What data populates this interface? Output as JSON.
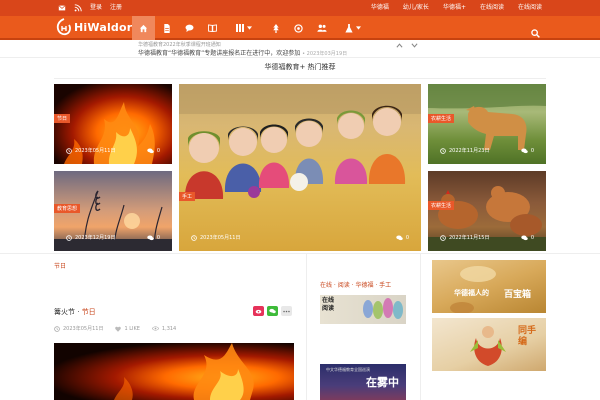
{
  "topbar": {
    "left_items": [
      "✉",
      "⤢",
      "登录",
      "注册"
    ],
    "right_items": [
      "华德福",
      "幼儿/家长",
      "华德福+",
      "在线阅读",
      "关于我们"
    ]
  },
  "nav": {
    "logo_text": "HiWaldorf",
    "items": [
      "home-icon",
      "file-icon",
      "comment-icon",
      "book-icon",
      "grid-icon",
      "tree-icon",
      "circle-icon",
      "users-icon",
      "flask-icon"
    ]
  },
  "ticker": {
    "line1": "华德福教育2022年秋季课程开班通知",
    "line2": "华德福教育“华德福教育”专题讲座报名正在进行中，欢迎参加",
    "date": "• 2023年03月19日"
  },
  "subtitle": "华德福教育+ 热门推荐",
  "tiles": [
    {
      "id": "fire",
      "cat": "节日",
      "date": "2023年05月11日",
      "comments": "0"
    },
    {
      "id": "felt",
      "cat": "手工",
      "date": "2023年05月11日",
      "comments": "0"
    },
    {
      "id": "cow",
      "cat": "农耕生活",
      "date": "2022年11月23日",
      "comments": "0"
    },
    {
      "id": "sunset",
      "cat": "教育思想",
      "date": "2023年12月19日",
      "comments": "0"
    },
    {
      "id": "hens",
      "cat": "农耕生活",
      "date": "2022年11月15日",
      "comments": "0"
    }
  ],
  "section": {
    "label": "节日"
  },
  "post": {
    "title": "篝火节",
    "title_sep": " · ",
    "category": "节日",
    "date": "2023年05月11日",
    "likes": "1 LIKE",
    "views": "1,314"
  },
  "middle": {
    "header": "在线 · 阅读 · 华德福 · 手工",
    "img1_label": "在线\n阅读",
    "img2_top": "中文华德福教育全国巡演",
    "img2_big": "在雾中"
  },
  "right": {
    "ad1_a": "华德福人的",
    "ad1_b": "百宝箱",
    "ad2": "同手编"
  },
  "colors": {
    "topbar": "#d9461a",
    "nav": "#ea5a1c",
    "accent": "#e9582a"
  }
}
